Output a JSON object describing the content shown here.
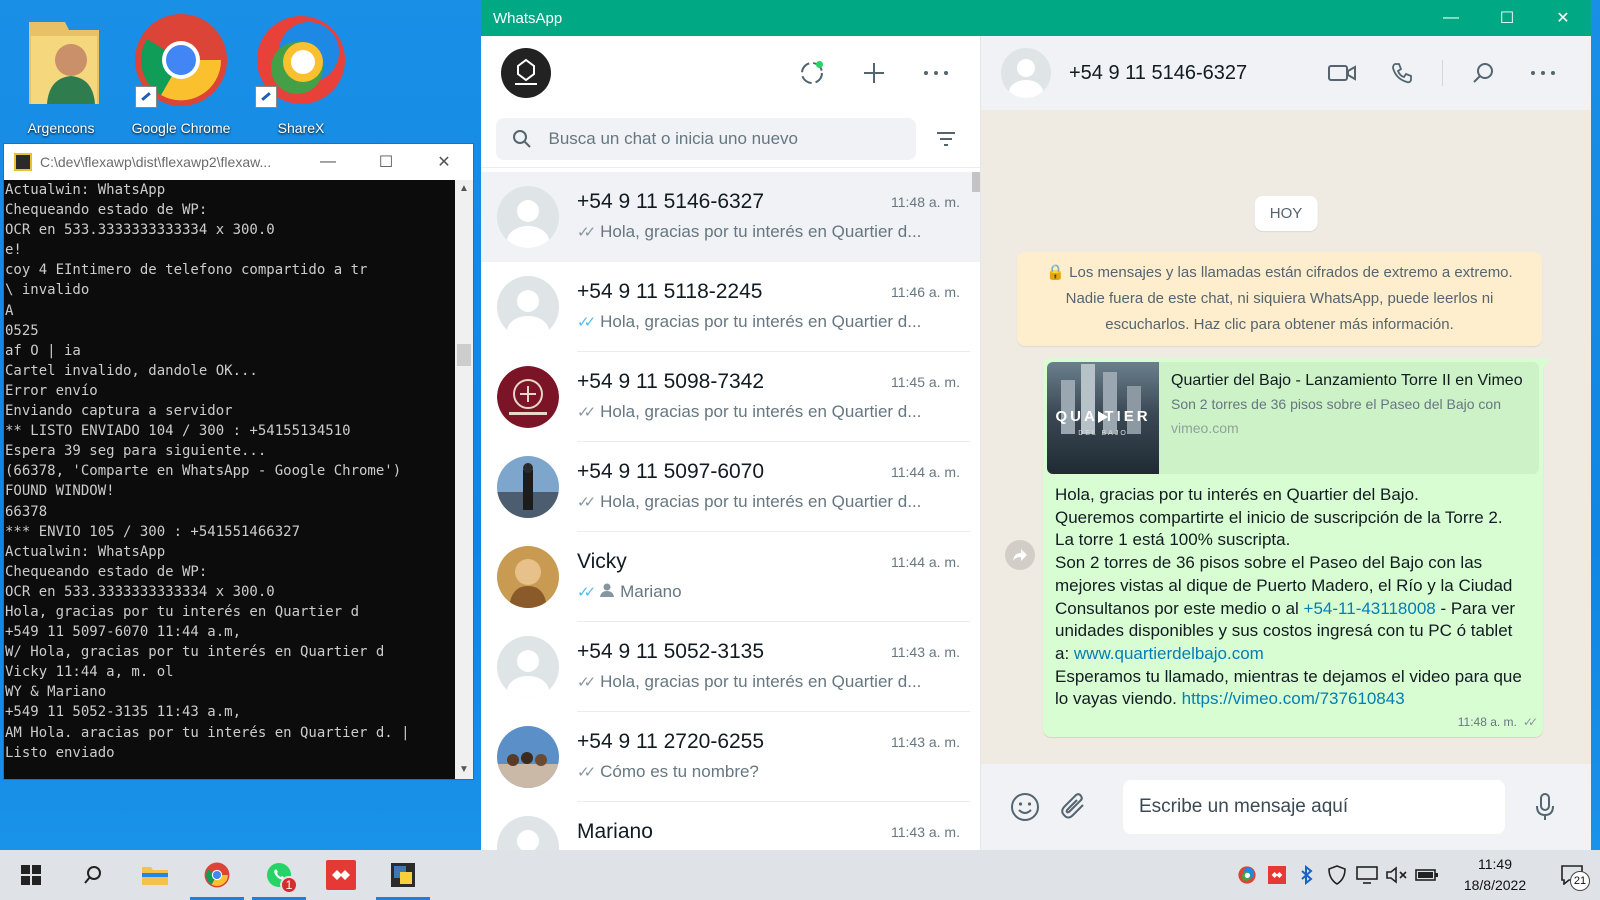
{
  "desktop": {
    "icons": [
      {
        "label": "Argencons"
      },
      {
        "label": "Google Chrome"
      },
      {
        "label": "ShareX"
      }
    ]
  },
  "console": {
    "title": "C:\\dev\\flexawp\\dist\\flexawp2\\flexaw...",
    "lines": [
      "Actualwin: WhatsApp",
      "Chequeando estado de WP:",
      "OCR en 533.3333333333334 x 300.0",
      "e!",
      "coy 4 EIntimero de telefono compartido a tr",
      "\\ invalido",
      "A",
      "0525",
      "af O | ia",
      "Cartel invalido, dandole OK...",
      "Error envío",
      "Enviando captura a servidor",
      "** LISTO ENVIADO 104 / 300 : +54155134510",
      "Espera 39 seg para siguiente...",
      "(66378, 'Comparte en WhatsApp - Google Chrome')",
      "FOUND WINDOW!",
      "66378",
      "*** ENVIO 105 / 300 : +541551466327",
      "Actualwin: WhatsApp",
      "Chequeando estado de WP:",
      "OCR en 533.3333333333334 x 300.0",
      "Hola, gracias por tu interés en Quartier d",
      "+549 11 5097-6070 11:44 a.m,",
      "W/ Hola, gracias por tu interés en Quartier d",
      "Vicky 11:44 a, m. ol",
      "WY & Mariano",
      "+549 11 5052-3135 11:43 a.m,",
      "AM Hola. aracias por tu interés en Quartier d. |",
      "Listo enviado"
    ]
  },
  "whatsapp": {
    "window_title": "WhatsApp",
    "search": {
      "placeholder": "Busca un chat o inicia uno nuevo"
    },
    "chats": [
      {
        "name": "+54 9 11 5146-6327",
        "time": "11:48 a. m.",
        "preview": "Hola, gracias por tu interés en Quartier d...",
        "tick": "sent",
        "avatar": "default",
        "active": true
      },
      {
        "name": "+54 9 11 5118-2245",
        "time": "11:46 a. m.",
        "preview": "Hola, gracias por tu interés en Quartier d...",
        "tick": "read",
        "avatar": "default",
        "active": false
      },
      {
        "name": "+54 9 11 5098-7342",
        "time": "11:45 a. m.",
        "preview": "Hola, gracias por tu interés en Quartier d...",
        "tick": "sent",
        "avatar": "seal",
        "active": false
      },
      {
        "name": "+54 9 11 5097-6070",
        "time": "11:44 a. m.",
        "preview": "Hola, gracias por tu interés en Quartier d...",
        "tick": "sent",
        "avatar": "photo-sky",
        "active": false
      },
      {
        "name": "Vicky",
        "time": "11:44 a. m.",
        "preview": "Mariano",
        "tick": "read",
        "avatar": "photo-warm",
        "active": false,
        "preview_icon": "person-icon"
      },
      {
        "name": "+54 9 11 5052-3135",
        "time": "11:43 a. m.",
        "preview": "Hola, gracias por tu interés en Quartier d...",
        "tick": "sent",
        "avatar": "default",
        "active": false
      },
      {
        "name": "+54 9 11 2720-6255",
        "time": "11:43 a. m.",
        "preview": "Cómo es tu nombre?",
        "tick": "sent",
        "avatar": "photo-group",
        "active": false
      },
      {
        "name": "Mariano",
        "time": "11:43 a. m.",
        "preview": "",
        "tick": "",
        "avatar": "default",
        "active": false
      }
    ],
    "conversation": {
      "contact_name": "+54 9 11 5146-6327",
      "day_label": "HOY",
      "encryption_notice": "Los mensajes y las llamadas están cifrados de extremo a extremo. Nadie fuera de este chat, ni siquiera WhatsApp, puede leerlos ni escucharlos. Haz clic para obtener más información.",
      "message": {
        "link_preview": {
          "title": "Quartier del Bajo - Lanzamiento Torre II en Vimeo",
          "description": "Son 2 torres de 36 pisos sobre el Paseo del Bajo con",
          "domain": "vimeo.com",
          "thumb_text": "QUA  TIER",
          "thumb_subtext": "DEL BAJO"
        },
        "line1": "Hola, gracias por tu interés en Quartier del Bajo.",
        "line2": "Queremos compartirte el inicio de suscripción de la Torre 2.",
        "line3": "La torre 1 está 100% suscripta.",
        "line4": "Son 2 torres de 36 pisos sobre el Paseo del Bajo con las mejores vistas al dique de Puerto Madero, el Río y la Ciudad",
        "line5_pre": "Consultanos por este medio o al ",
        "phone_link": "+54-11-43118008",
        "line5_post": " - Para ver unidades disponibles y sus costos ingresá con tu PC ó tablet a: ",
        "site_link": "www.quartierdelbajo.com",
        "line6_pre": "Esperamos tu llamado, mientras te dejamos el video para que lo vayas viendo. ",
        "video_link": "https://vimeo.com/737610843",
        "time": "11:48 a. m."
      },
      "composer_placeholder": "Escribe un mensaje aquí"
    }
  },
  "taskbar": {
    "whatsapp_badge": "1",
    "clock_time": "11:49",
    "clock_date": "18/8/2022",
    "notification_count": "21"
  },
  "colors": {
    "whatsapp_green": "#00a884",
    "read_tick": "#53bdeb",
    "link": "#027eb5",
    "bubble_out": "#d9fdd3"
  }
}
